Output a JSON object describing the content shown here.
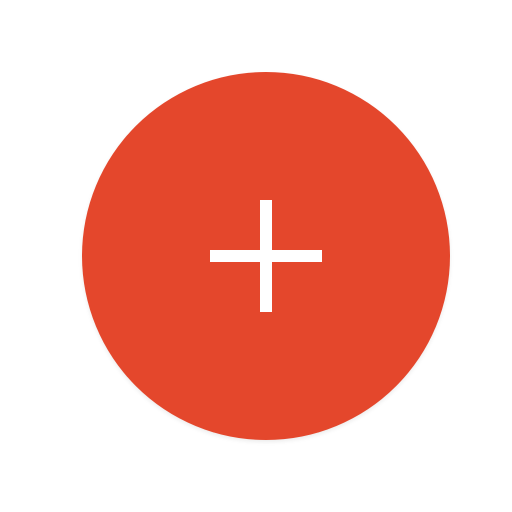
{
  "fab": {
    "action": "add",
    "icon": "plus-icon",
    "background_color": "#E4472C",
    "icon_color": "#FFFFFF"
  },
  "page": {
    "background_color": "#FFFFFF"
  }
}
